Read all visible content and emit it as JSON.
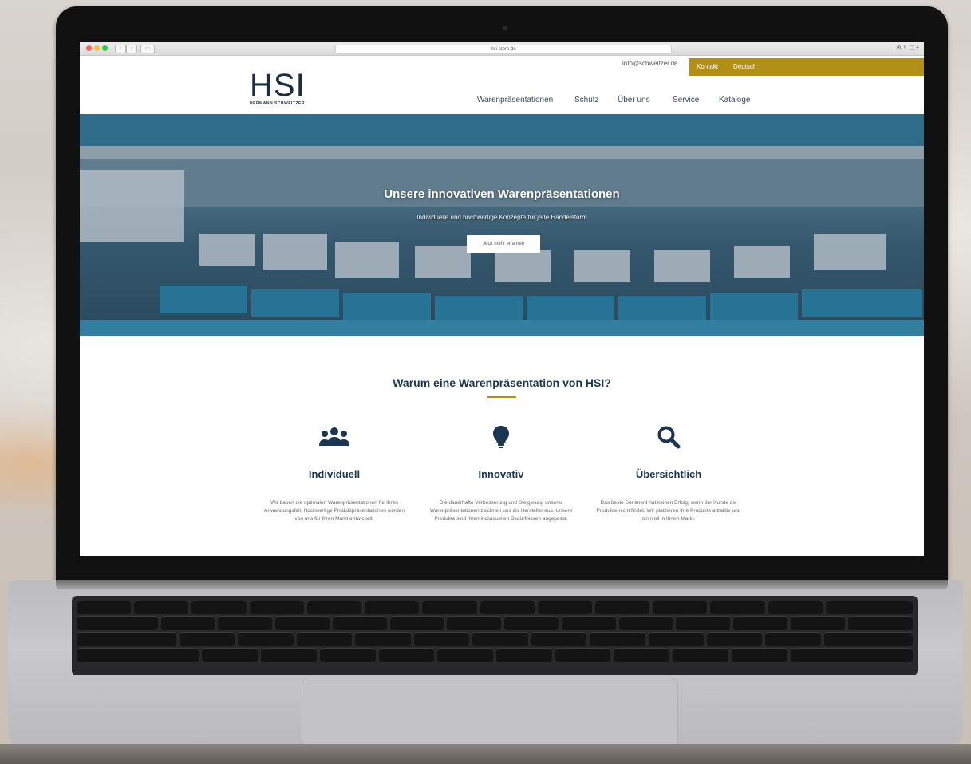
{
  "browser": {
    "url": "hsi-store.de"
  },
  "topbar": {
    "email": "info@schweitzer.de",
    "contact_label": "Kontakt",
    "language_label": "Deutsch"
  },
  "logo": {
    "main": "HSI",
    "sub": "HERMANN SCHWEITZER"
  },
  "nav": {
    "items": [
      "Warenpräsentationen",
      "Schutz",
      "Über uns",
      "Service",
      "Kataloge"
    ]
  },
  "hero": {
    "title": "Unsere innovativen Warenpräsentationen",
    "subtitle": "Individuelle und hochwertige Konzepte für jede Handelsform",
    "button_label": "Jetzt mehr erfahren"
  },
  "why": {
    "title": "Warum eine Warenpräsentation von HSI?",
    "features": [
      {
        "icon": "users-icon",
        "title": "Individuell",
        "text": "Wir bauen die optimalen Warenpräsentationen für Ihren Anwendungsfall. Hochwertige Produktpräsentationen werden von uns für Ihren Markt entwickelt."
      },
      {
        "icon": "lightbulb-icon",
        "title": "Innovativ",
        "text": "Die dauerhafte Verbesserung und Steigerung unserer Warenpräsentationen zeichnen uns als Hersteller aus. Unsere Produkte sind Ihren individuellen Bedürfnissen angepasst."
      },
      {
        "icon": "search-icon",
        "title": "Übersichtlich",
        "text": "Das beste Sortiment hat keinen Erfolg, wenn der Kunde die Produkte nicht findet. Wir platzieren Ihre Produkte attraktiv und sinnvoll in Ihrem Markt."
      }
    ]
  },
  "colors": {
    "accent_gold": "#b28f17",
    "brand_navy": "#1c3550"
  }
}
